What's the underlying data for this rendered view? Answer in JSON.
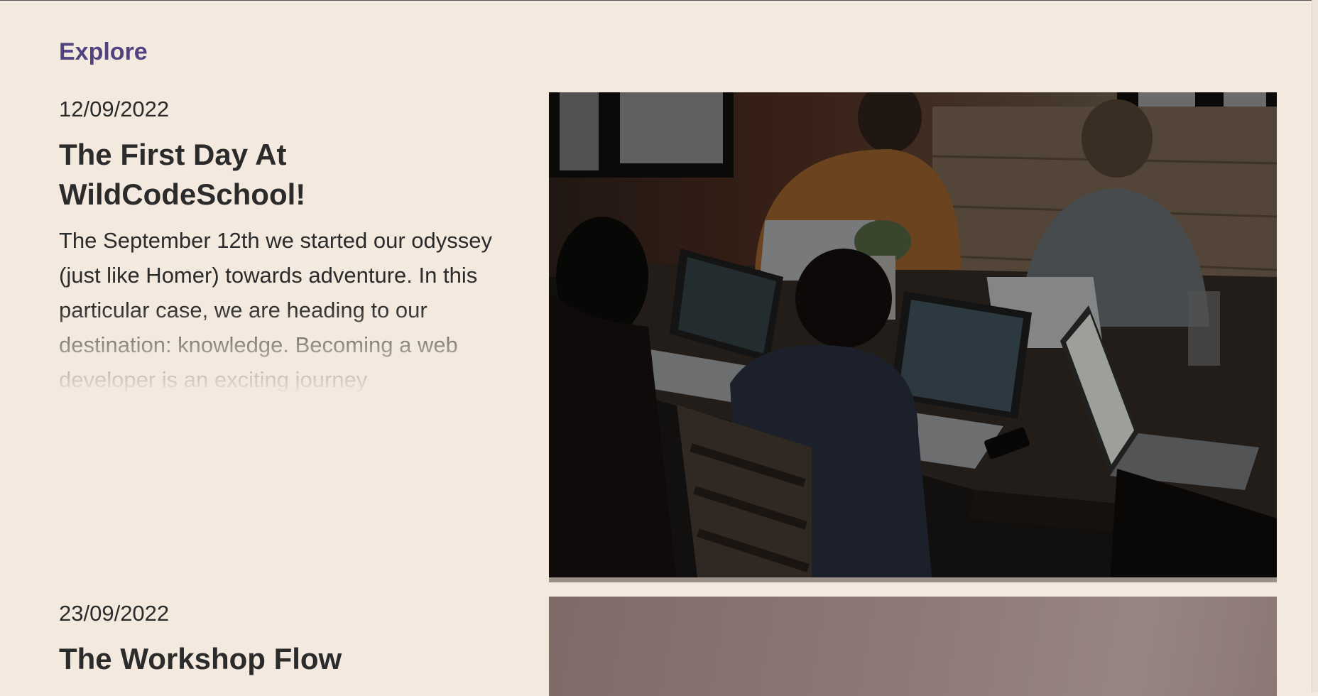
{
  "section": {
    "title": "Explore"
  },
  "posts": [
    {
      "date": "12/09/2022",
      "title": "The First Day At WildCodeSchool!",
      "excerpt": "The September 12th we started our odyssey (just like Homer) towards adventure. In this particular case, we are heading to our destination: knowledge. Becoming a web developer is an exciting journey",
      "image": "photo of students working on laptops around a wooden table"
    },
    {
      "date": "23/09/2022",
      "title": "The Workshop Flow",
      "image": "photo with blurred mauve background"
    }
  ],
  "colors": {
    "background": "#f3e9de",
    "accent": "#4f4480",
    "text": "#2b2b2b"
  }
}
